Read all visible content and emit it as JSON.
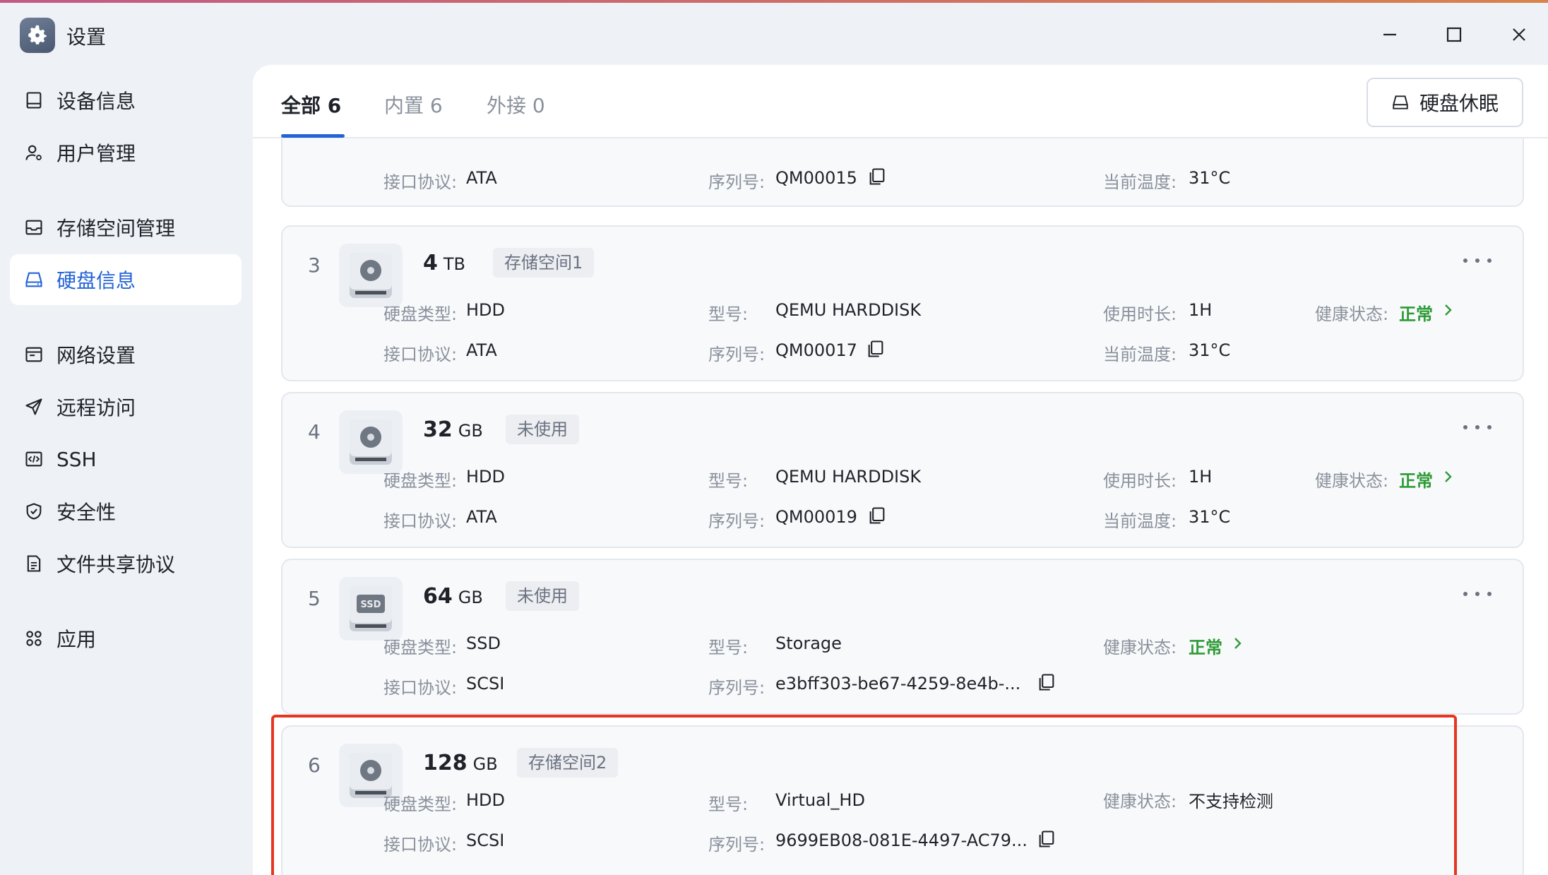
{
  "window": {
    "title": "设置"
  },
  "sidebar": {
    "items": [
      {
        "label": "设备信息",
        "icon": "device-info-icon"
      },
      {
        "label": "用户管理",
        "icon": "user-icon"
      },
      {
        "label": "存储空间管理",
        "icon": "storage-icon"
      },
      {
        "label": "硬盘信息",
        "icon": "hard-disk-icon",
        "active": true
      },
      {
        "label": "网络设置",
        "icon": "network-icon"
      },
      {
        "label": "远程访问",
        "icon": "remote-access-icon"
      },
      {
        "label": "SSH",
        "icon": "ssh-icon"
      },
      {
        "label": "安全性",
        "icon": "shield-icon"
      },
      {
        "label": "文件共享协议",
        "icon": "file-share-icon"
      },
      {
        "label": "应用",
        "icon": "apps-icon"
      }
    ]
  },
  "tabs": [
    {
      "label": "全部 6",
      "active": true
    },
    {
      "label": "内置 6"
    },
    {
      "label": "外接 0"
    }
  ],
  "sleep_button": {
    "label": "硬盘休眠"
  },
  "labels": {
    "disk_type": "硬盘类型:",
    "model": "型号:",
    "usage_time": "使用时长:",
    "health": "健康状态:",
    "interface": "接口协议:",
    "serial": "序列号:",
    "temperature": "当前温度:"
  },
  "disks": [
    {
      "interface": "ATA",
      "serial": "QM00015",
      "temperature": "31°C"
    },
    {
      "index": "3",
      "capacity": "4",
      "unit": "TB",
      "tag": "存储空间1",
      "type": "HDD",
      "model": "QEMU HARDDISK",
      "usage": "1H",
      "health": "正常",
      "interface": "ATA",
      "serial": "QM00017",
      "temperature": "31°C"
    },
    {
      "index": "4",
      "capacity": "32",
      "unit": "GB",
      "tag": "未使用",
      "type": "HDD",
      "model": "QEMU HARDDISK",
      "usage": "1H",
      "health": "正常",
      "interface": "ATA",
      "serial": "QM00019",
      "temperature": "31°C"
    },
    {
      "index": "5",
      "capacity": "64",
      "unit": "GB",
      "tag": "未使用",
      "type": "SSD",
      "model": "Storage",
      "health": "正常",
      "interface": "SCSI",
      "serial": "e3bff303-be67-4259-8e4b-..."
    },
    {
      "index": "6",
      "capacity": "128",
      "unit": "GB",
      "tag": "存储空间2",
      "type": "HDD",
      "model": "Virtual_HD",
      "health": "不支持检测",
      "interface": "SCSI",
      "serial": "9699EB08-081E-4497-AC79..."
    }
  ],
  "colors": {
    "accent": "#2463d6",
    "healthy": "#2e9b36",
    "highlight": "#e5361f"
  }
}
